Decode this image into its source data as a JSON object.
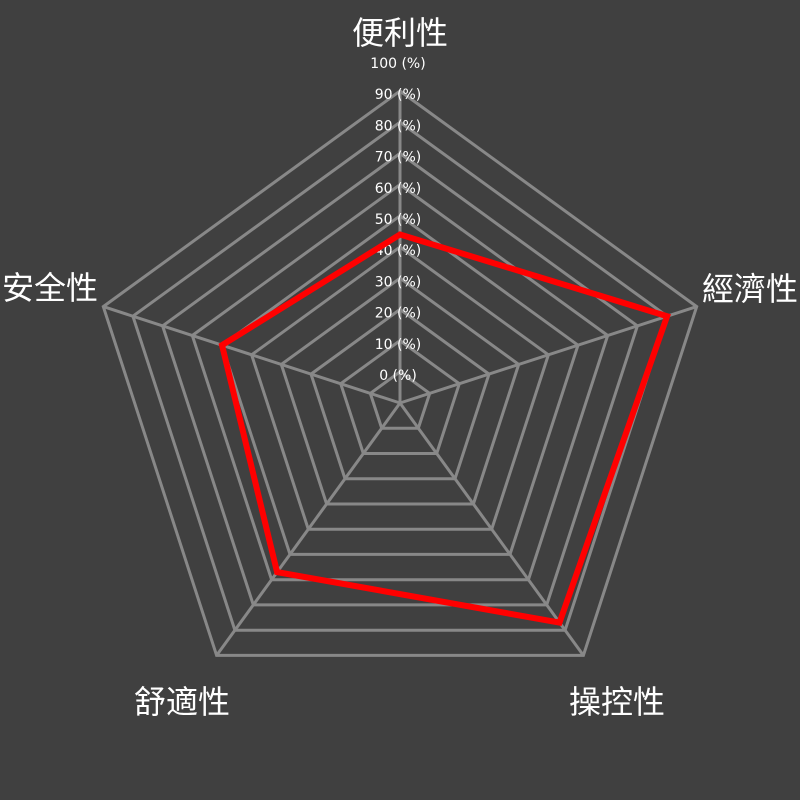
{
  "chart_data": {
    "type": "radar",
    "axes": [
      "便利性",
      "經濟性",
      "操控性",
      "舒適性",
      "安全性"
    ],
    "tick_labels": [
      "0 (%)",
      "10 (%)",
      "20 (%)",
      "30 (%)",
      "40 (%)",
      "50 (%)",
      "60 (%)",
      "70 (%)",
      "80 (%)",
      "90 (%)",
      "100 (%)"
    ],
    "range": [
      0,
      100
    ],
    "ring_step": 10,
    "series": [
      {
        "values": [
          54,
          90,
          87,
          67,
          60
        ]
      }
    ],
    "grid": true,
    "legend": "none"
  },
  "colors": {
    "background": "#404040",
    "grid": "#888888",
    "text": "#ffffff",
    "series": "#ff0000"
  }
}
